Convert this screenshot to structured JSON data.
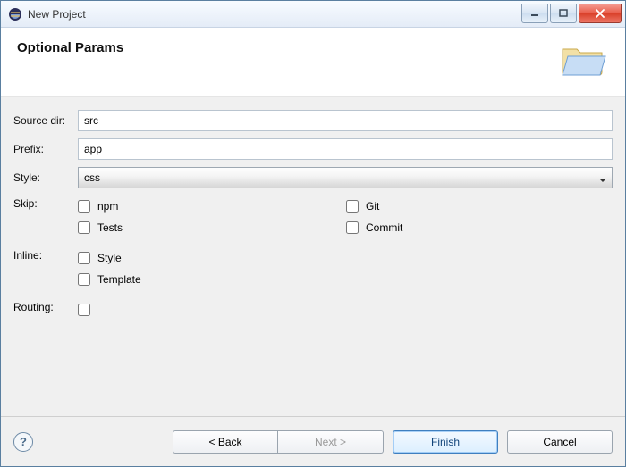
{
  "window": {
    "title": "New Project"
  },
  "header": {
    "title": "Optional Params"
  },
  "form": {
    "sourceDir": {
      "label": "Source dir:",
      "value": "src"
    },
    "prefix": {
      "label": "Prefix:",
      "value": "app"
    },
    "style": {
      "label": "Style:",
      "value": "css"
    },
    "skip": {
      "label": "Skip:",
      "npm": {
        "label": "npm",
        "checked": false
      },
      "tests": {
        "label": "Tests",
        "checked": false
      },
      "git": {
        "label": "Git",
        "checked": false
      },
      "commit": {
        "label": "Commit",
        "checked": false
      }
    },
    "inline": {
      "label": "Inline:",
      "style": {
        "label": "Style",
        "checked": false
      },
      "template": {
        "label": "Template",
        "checked": false
      }
    },
    "routing": {
      "label": "Routing:",
      "checked": false
    }
  },
  "buttons": {
    "back": "< Back",
    "next": "Next >",
    "finish": "Finish",
    "cancel": "Cancel"
  }
}
